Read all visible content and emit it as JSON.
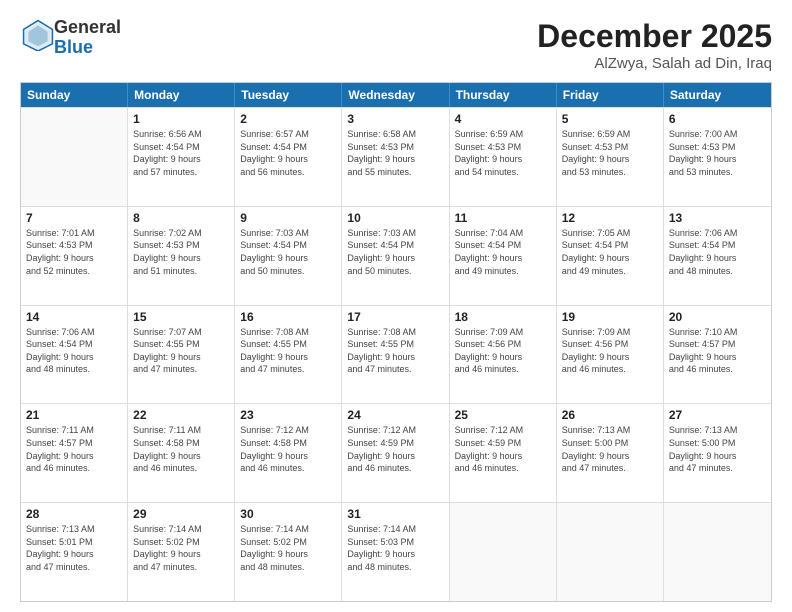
{
  "header": {
    "logo_general": "General",
    "logo_blue": "Blue",
    "month_title": "December 2025",
    "location": "AlZwya, Salah ad Din, Iraq"
  },
  "days_of_week": [
    "Sunday",
    "Monday",
    "Tuesday",
    "Wednesday",
    "Thursday",
    "Friday",
    "Saturday"
  ],
  "weeks": [
    [
      {
        "day": "",
        "info": ""
      },
      {
        "day": "1",
        "info": "Sunrise: 6:56 AM\nSunset: 4:54 PM\nDaylight: 9 hours\nand 57 minutes."
      },
      {
        "day": "2",
        "info": "Sunrise: 6:57 AM\nSunset: 4:54 PM\nDaylight: 9 hours\nand 56 minutes."
      },
      {
        "day": "3",
        "info": "Sunrise: 6:58 AM\nSunset: 4:53 PM\nDaylight: 9 hours\nand 55 minutes."
      },
      {
        "day": "4",
        "info": "Sunrise: 6:59 AM\nSunset: 4:53 PM\nDaylight: 9 hours\nand 54 minutes."
      },
      {
        "day": "5",
        "info": "Sunrise: 6:59 AM\nSunset: 4:53 PM\nDaylight: 9 hours\nand 53 minutes."
      },
      {
        "day": "6",
        "info": "Sunrise: 7:00 AM\nSunset: 4:53 PM\nDaylight: 9 hours\nand 53 minutes."
      }
    ],
    [
      {
        "day": "7",
        "info": "Sunrise: 7:01 AM\nSunset: 4:53 PM\nDaylight: 9 hours\nand 52 minutes."
      },
      {
        "day": "8",
        "info": "Sunrise: 7:02 AM\nSunset: 4:53 PM\nDaylight: 9 hours\nand 51 minutes."
      },
      {
        "day": "9",
        "info": "Sunrise: 7:03 AM\nSunset: 4:54 PM\nDaylight: 9 hours\nand 50 minutes."
      },
      {
        "day": "10",
        "info": "Sunrise: 7:03 AM\nSunset: 4:54 PM\nDaylight: 9 hours\nand 50 minutes."
      },
      {
        "day": "11",
        "info": "Sunrise: 7:04 AM\nSunset: 4:54 PM\nDaylight: 9 hours\nand 49 minutes."
      },
      {
        "day": "12",
        "info": "Sunrise: 7:05 AM\nSunset: 4:54 PM\nDaylight: 9 hours\nand 49 minutes."
      },
      {
        "day": "13",
        "info": "Sunrise: 7:06 AM\nSunset: 4:54 PM\nDaylight: 9 hours\nand 48 minutes."
      }
    ],
    [
      {
        "day": "14",
        "info": "Sunrise: 7:06 AM\nSunset: 4:54 PM\nDaylight: 9 hours\nand 48 minutes."
      },
      {
        "day": "15",
        "info": "Sunrise: 7:07 AM\nSunset: 4:55 PM\nDaylight: 9 hours\nand 47 minutes."
      },
      {
        "day": "16",
        "info": "Sunrise: 7:08 AM\nSunset: 4:55 PM\nDaylight: 9 hours\nand 47 minutes."
      },
      {
        "day": "17",
        "info": "Sunrise: 7:08 AM\nSunset: 4:55 PM\nDaylight: 9 hours\nand 47 minutes."
      },
      {
        "day": "18",
        "info": "Sunrise: 7:09 AM\nSunset: 4:56 PM\nDaylight: 9 hours\nand 46 minutes."
      },
      {
        "day": "19",
        "info": "Sunrise: 7:09 AM\nSunset: 4:56 PM\nDaylight: 9 hours\nand 46 minutes."
      },
      {
        "day": "20",
        "info": "Sunrise: 7:10 AM\nSunset: 4:57 PM\nDaylight: 9 hours\nand 46 minutes."
      }
    ],
    [
      {
        "day": "21",
        "info": "Sunrise: 7:11 AM\nSunset: 4:57 PM\nDaylight: 9 hours\nand 46 minutes."
      },
      {
        "day": "22",
        "info": "Sunrise: 7:11 AM\nSunset: 4:58 PM\nDaylight: 9 hours\nand 46 minutes."
      },
      {
        "day": "23",
        "info": "Sunrise: 7:12 AM\nSunset: 4:58 PM\nDaylight: 9 hours\nand 46 minutes."
      },
      {
        "day": "24",
        "info": "Sunrise: 7:12 AM\nSunset: 4:59 PM\nDaylight: 9 hours\nand 46 minutes."
      },
      {
        "day": "25",
        "info": "Sunrise: 7:12 AM\nSunset: 4:59 PM\nDaylight: 9 hours\nand 46 minutes."
      },
      {
        "day": "26",
        "info": "Sunrise: 7:13 AM\nSunset: 5:00 PM\nDaylight: 9 hours\nand 47 minutes."
      },
      {
        "day": "27",
        "info": "Sunrise: 7:13 AM\nSunset: 5:00 PM\nDaylight: 9 hours\nand 47 minutes."
      }
    ],
    [
      {
        "day": "28",
        "info": "Sunrise: 7:13 AM\nSunset: 5:01 PM\nDaylight: 9 hours\nand 47 minutes."
      },
      {
        "day": "29",
        "info": "Sunrise: 7:14 AM\nSunset: 5:02 PM\nDaylight: 9 hours\nand 47 minutes."
      },
      {
        "day": "30",
        "info": "Sunrise: 7:14 AM\nSunset: 5:02 PM\nDaylight: 9 hours\nand 48 minutes."
      },
      {
        "day": "31",
        "info": "Sunrise: 7:14 AM\nSunset: 5:03 PM\nDaylight: 9 hours\nand 48 minutes."
      },
      {
        "day": "",
        "info": ""
      },
      {
        "day": "",
        "info": ""
      },
      {
        "day": "",
        "info": ""
      }
    ]
  ]
}
